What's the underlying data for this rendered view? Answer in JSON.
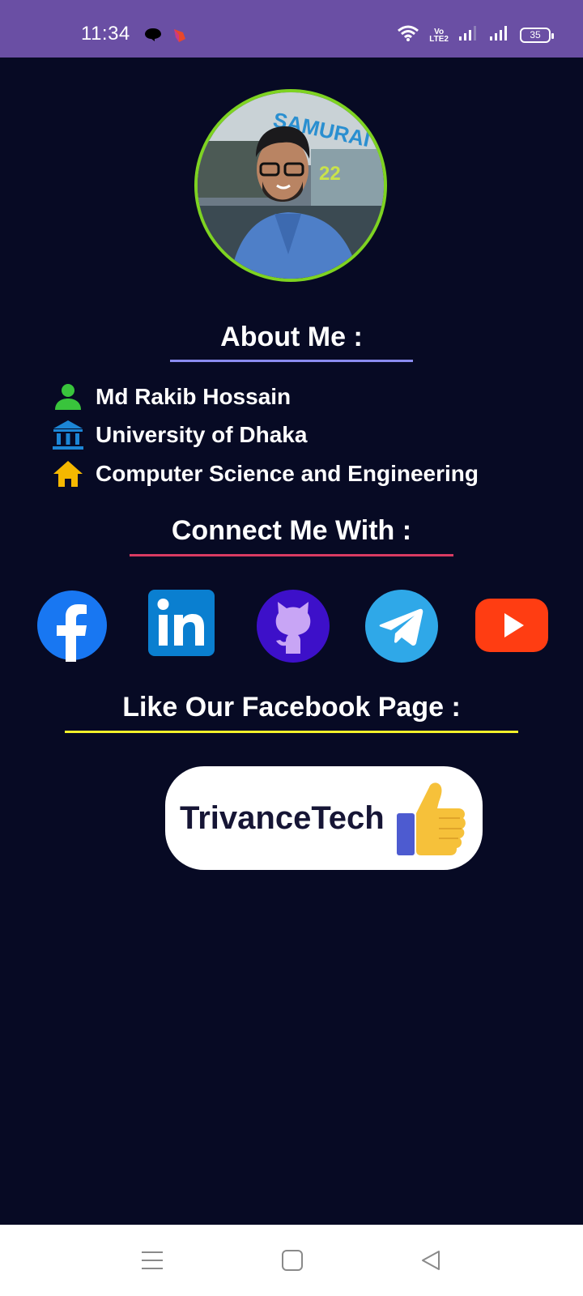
{
  "status_bar": {
    "time": "11:34",
    "network_label_top": "Vo",
    "network_label_bottom": "LTE2",
    "battery": "35",
    "icons": [
      "chat-notification-icon",
      "app-notification-icon",
      "wifi-icon",
      "volte-icon",
      "signal-icon",
      "signal-icon",
      "battery-icon"
    ]
  },
  "profile": {
    "photo_sign_text": "SAMURAI",
    "photo_sign_number": "22"
  },
  "about": {
    "heading": "About Me :",
    "underline_color": "#8a8cf0",
    "items": [
      {
        "icon": "person-icon",
        "text": "Md Rakib Hossain"
      },
      {
        "icon": "university-icon",
        "text": "University of Dhaka"
      },
      {
        "icon": "home-icon",
        "text": "Computer Science and Engineering"
      }
    ]
  },
  "connect": {
    "heading": "Connect Me With :",
    "underline_color": "#d93b62",
    "links": [
      {
        "icon": "facebook-icon",
        "color": "#1877f2"
      },
      {
        "icon": "linkedin-icon",
        "color": "#0a7fd0"
      },
      {
        "icon": "github-icon",
        "color": "#3d10c9"
      },
      {
        "icon": "telegram-icon",
        "color": "#2fa8e8"
      },
      {
        "icon": "youtube-icon",
        "color": "#ff3d12"
      }
    ]
  },
  "like_page": {
    "heading": "Like Our Facebook Page :",
    "underline_color": "#f2f02a",
    "button_label": "TrivanceTech",
    "button_icon": "thumbs-up-icon"
  },
  "nav_bar": {
    "buttons": [
      "menu-icon",
      "home-square-icon",
      "back-triangle-icon"
    ]
  },
  "colors": {
    "background": "#070a24",
    "status_bar": "#6a4fa4",
    "avatar_border": "#7ed321"
  }
}
